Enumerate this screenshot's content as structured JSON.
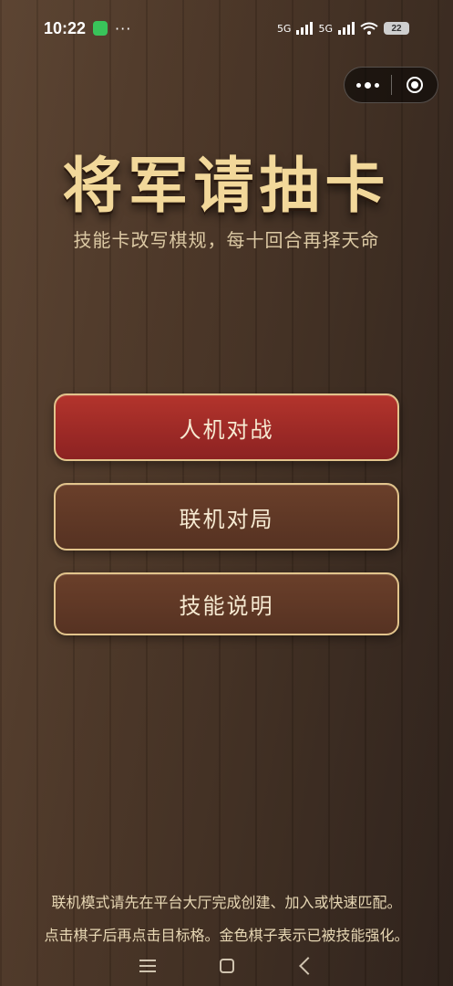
{
  "status_bar": {
    "time": "10:22",
    "dots": "···",
    "network1": "5G",
    "network2": "5G",
    "battery": "22"
  },
  "capsule": {
    "more_icon": "more-dots-icon",
    "close_icon": "target-icon"
  },
  "title": "将军请抽卡",
  "subtitle": "技能卡改写棋规，每十回合再择天命",
  "buttons": {
    "ai": "人机对战",
    "online": "联机对局",
    "help": "技能说明"
  },
  "footer": {
    "line1": "联机模式请先在平台大厅完成创建、加入或快速匹配。",
    "line2": "点击棋子后再点击目标格。金色棋子表示已被技能强化。"
  },
  "colors": {
    "title": "#f2d89a",
    "primary_button": "#a12b27",
    "secondary_button": "#5f3826",
    "button_border": "#e2c48c"
  }
}
